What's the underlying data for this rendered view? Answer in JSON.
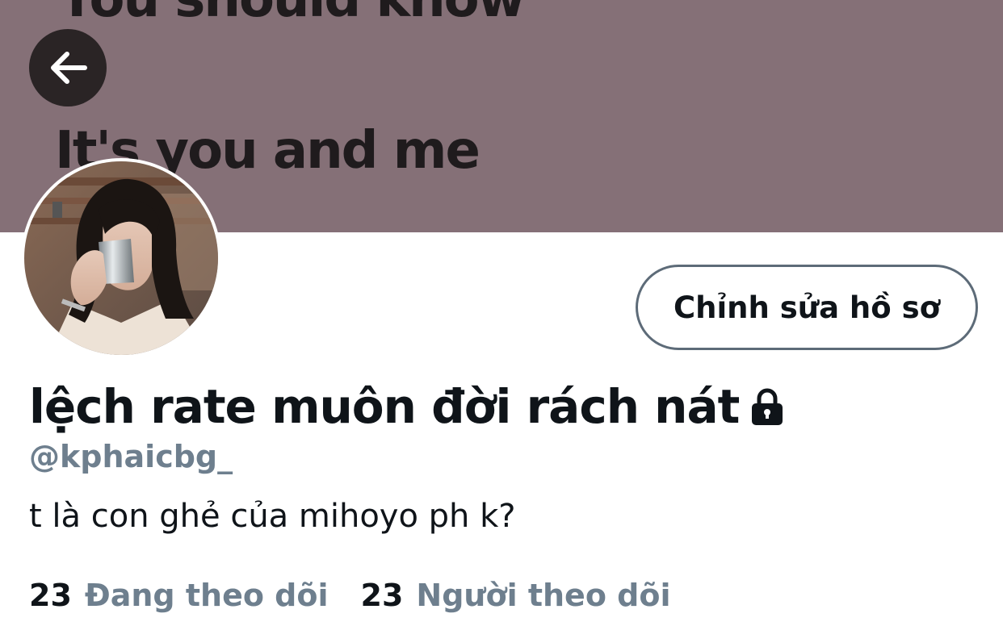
{
  "banner": {
    "line1": "You should know",
    "line2": "It's you and me",
    "background_color": "#857077"
  },
  "back_button": {
    "icon": "arrow-left-icon"
  },
  "edit_profile_button": {
    "label": "Chỉnh sửa hồ sơ"
  },
  "profile": {
    "display_name": "lệch rate muôn đời rách nát",
    "protected_icon": "lock-icon",
    "handle": "@kphaicbg_",
    "bio": "t là con ghẻ của mihoyo ph k?"
  },
  "stats": [
    {
      "count": "23",
      "label": "Đang theo dõi"
    },
    {
      "count": "23",
      "label": "Người theo dõi"
    }
  ],
  "colors": {
    "text_primary": "#0f1419",
    "text_secondary": "#6e7f8e",
    "button_border": "#5d6b78"
  }
}
